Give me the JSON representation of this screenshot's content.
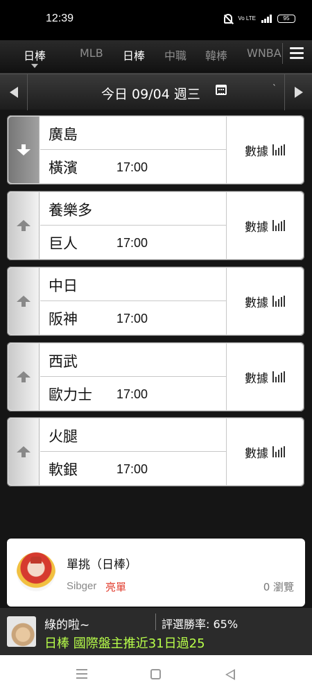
{
  "status_bar": {
    "time": "12:39",
    "battery": "95",
    "volte": "Vo LTE"
  },
  "nav": {
    "current": "日棒",
    "tabs": [
      "MLB",
      "日棒",
      "中職",
      "韓棒",
      "WNBA"
    ]
  },
  "date_bar": {
    "label": "今日 09/04 週三",
    "extra_mark": "`"
  },
  "games": [
    {
      "away": "廣島",
      "home": "橫濱",
      "time": "17:00",
      "stats_label": "數據",
      "selected": true
    },
    {
      "away": "養樂多",
      "home": "巨人",
      "time": "17:00",
      "stats_label": "數據",
      "selected": false
    },
    {
      "away": "中日",
      "home": "阪神",
      "time": "17:00",
      "stats_label": "數據",
      "selected": false
    },
    {
      "away": "西武",
      "home": "歐力士",
      "time": "17:00",
      "stats_label": "數據",
      "selected": false
    },
    {
      "away": "火腿",
      "home": "軟銀",
      "time": "17:00",
      "stats_label": "數據",
      "selected": false
    }
  ],
  "pick": {
    "title": "單挑（日棒）",
    "user": "Sibger",
    "tag": "亮單",
    "views": "0 瀏覽"
  },
  "ticker": {
    "user": "綠的啦~",
    "rate": "評選勝率: 65%",
    "message": "日棒 國際盤主推近31日過25"
  },
  "colors": {
    "accent_green": "#b8ff4a",
    "tag_red": "#e13b2c"
  }
}
